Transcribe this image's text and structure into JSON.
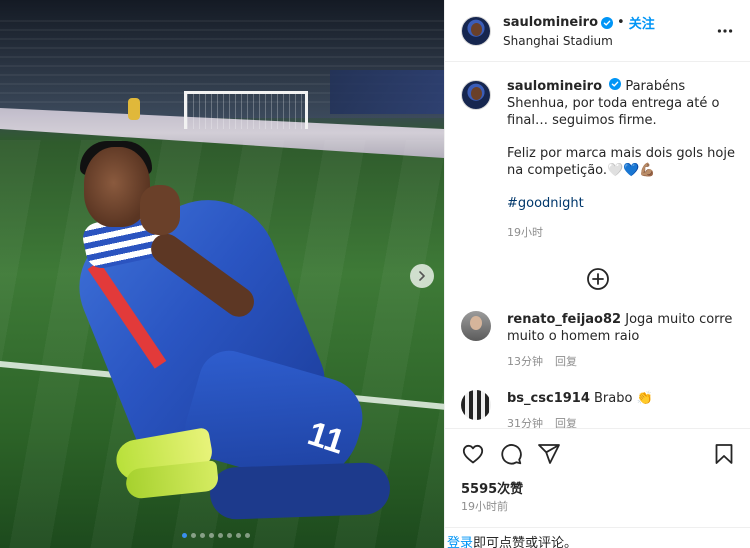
{
  "header": {
    "username": "saulomineiro",
    "separator": "•",
    "follow_label": "关注",
    "location": "Shanghai Stadium",
    "more_icon": "more-horizontal-icon"
  },
  "photo": {
    "jersey_number": "11",
    "carousel_total": 8,
    "carousel_active": 1
  },
  "caption": {
    "username": "saulomineiro",
    "text_line1": "Parabéns Shenhua, por toda entrega até o final… seguimos firme.",
    "text_line2": "Feliz por marca mais dois gols hoje na competição.🤍💙💪🏽",
    "hashtag": "#goodnight",
    "time": "19小时"
  },
  "comments": [
    {
      "username": "renato_feijao82",
      "text": "Joga muito corre muito o homem raio",
      "time": "13分钟",
      "reply_label": "回复"
    },
    {
      "username": "bs_csc1914",
      "text": "Brabo 👏",
      "time": "31分钟",
      "reply_label": "回复"
    }
  ],
  "stats": {
    "likes": "5595次赞",
    "time": "19小时前"
  },
  "footer": {
    "login_link": "登录",
    "login_text": "即可点赞或评论。"
  },
  "colors": {
    "accent": "#0095f6",
    "hashtag": "#00376b",
    "muted": "#8e8e8e"
  }
}
